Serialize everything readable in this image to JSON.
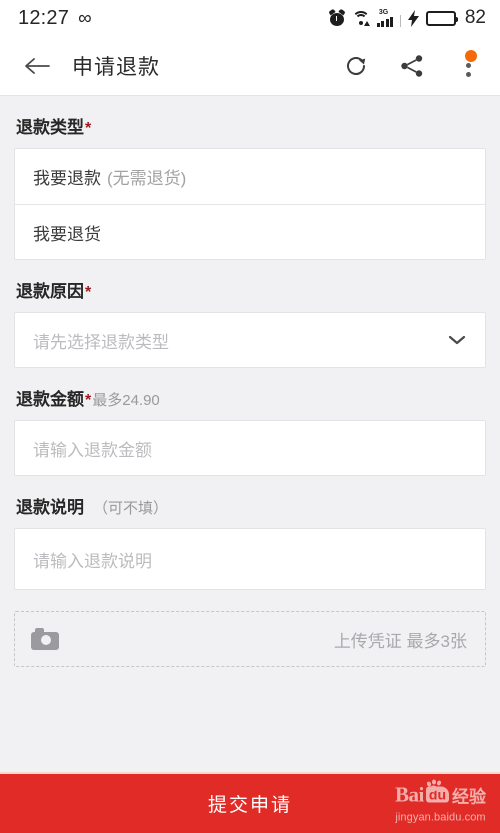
{
  "status_bar": {
    "time": "12:27",
    "infinity": "∞",
    "alarm_icon": "alarm-clock-icon",
    "wifi_icon": "wifi-icon",
    "network_type": "3G",
    "charging_icon": "charging-bolt-icon",
    "battery_icon": "battery-icon",
    "battery_level": "82"
  },
  "app_bar": {
    "back_icon": "back-arrow-icon",
    "title": "申请退款",
    "refresh_icon": "refresh-icon",
    "share_icon": "share-icon",
    "menu_icon": "more-vertical-icon",
    "menu_badge_color": "#f26a0a"
  },
  "form": {
    "refund_type": {
      "label": "退款类型",
      "required_mark": "*",
      "options": [
        {
          "main": "我要退款",
          "sub": "(无需退货)"
        },
        {
          "main": "我要退货",
          "sub": ""
        }
      ]
    },
    "refund_reason": {
      "label": "退款原因",
      "required_mark": "*",
      "placeholder": "请先选择退款类型",
      "chevron_icon": "chevron-down-icon"
    },
    "refund_amount": {
      "label": "退款金额",
      "required_mark": "*",
      "max_hint": "最多24.90",
      "placeholder": "请输入退款金额"
    },
    "refund_note": {
      "label": "退款说明",
      "optional_hint": "（可不填）",
      "placeholder": "请输入退款说明"
    },
    "upload": {
      "camera_icon": "camera-icon",
      "text": "上传凭证 最多3张"
    }
  },
  "submit": {
    "label": "提交申请",
    "background_color": "#e02b26"
  },
  "watermark": {
    "brand": "Bai",
    "brand_mark": "du",
    "brand_suffix": "经验",
    "url": "jingyan.baidu.com"
  }
}
